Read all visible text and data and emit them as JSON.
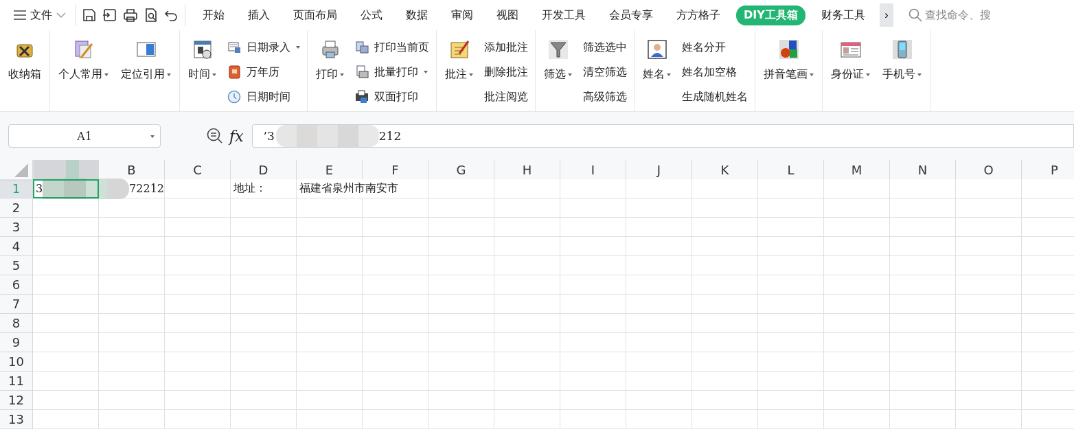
{
  "menu_button": {
    "label": "文件"
  },
  "tabs": [
    {
      "label": "开始",
      "selected": false
    },
    {
      "label": "插入",
      "selected": false
    },
    {
      "label": "页面布局",
      "selected": false
    },
    {
      "label": "公式",
      "selected": false
    },
    {
      "label": "数据",
      "selected": false
    },
    {
      "label": "审阅",
      "selected": false
    },
    {
      "label": "视图",
      "selected": false
    },
    {
      "label": "开发工具",
      "selected": false
    },
    {
      "label": "会员专享",
      "selected": false
    },
    {
      "label": "方方格子",
      "selected": false
    },
    {
      "label": "DIY工具箱",
      "selected": true
    },
    {
      "label": "财务工具",
      "selected": false
    }
  ],
  "more_tabs": "›",
  "search": {
    "placeholder": "查找命令、搜"
  },
  "ribbon_groups": [
    {
      "items": [
        {
          "kind": "large",
          "label": "收纳箱",
          "dropdown": false
        }
      ]
    },
    {
      "items": [
        {
          "kind": "large",
          "label": "个人常用",
          "dropdown": true
        },
        {
          "kind": "large",
          "label": "定位引用",
          "dropdown": true
        }
      ]
    },
    {
      "items": [
        {
          "kind": "large",
          "label": "时间",
          "dropdown": true
        },
        {
          "kind": "column",
          "with_icons": true,
          "items": [
            {
              "label": "日期录入",
              "dropdown": true
            },
            {
              "label": "万年历",
              "dropdown": false
            },
            {
              "label": "日期时间",
              "dropdown": false
            }
          ]
        }
      ]
    },
    {
      "items": [
        {
          "kind": "large",
          "label": "打印",
          "dropdown": true
        },
        {
          "kind": "column",
          "with_icons": true,
          "items": [
            {
              "label": "打印当前页",
              "dropdown": false
            },
            {
              "label": "批量打印",
              "dropdown": true
            },
            {
              "label": "双面打印",
              "dropdown": false
            }
          ]
        }
      ]
    },
    {
      "items": [
        {
          "kind": "large",
          "label": "批注",
          "dropdown": true
        },
        {
          "kind": "column",
          "with_icons": false,
          "items": [
            {
              "label": "添加批注",
              "dropdown": false
            },
            {
              "label": "删除批注",
              "dropdown": false
            },
            {
              "label": "批注阅览",
              "dropdown": false
            }
          ]
        }
      ]
    },
    {
      "items": [
        {
          "kind": "large",
          "label": "筛选",
          "dropdown": true
        },
        {
          "kind": "column",
          "with_icons": false,
          "items": [
            {
              "label": "筛选选中",
              "dropdown": false
            },
            {
              "label": "清空筛选",
              "dropdown": false
            },
            {
              "label": "高级筛选",
              "dropdown": false
            }
          ]
        }
      ]
    },
    {
      "items": [
        {
          "kind": "large",
          "label": "姓名",
          "dropdown": true
        },
        {
          "kind": "column",
          "with_icons": false,
          "items": [
            {
              "label": "姓名分开",
              "dropdown": false
            },
            {
              "label": "姓名加空格",
              "dropdown": false
            },
            {
              "label": "生成随机姓名",
              "dropdown": false
            }
          ]
        }
      ]
    },
    {
      "items": [
        {
          "kind": "large",
          "label": "拼音笔画",
          "dropdown": true
        }
      ]
    },
    {
      "items": [
        {
          "kind": "large",
          "label": "身份证",
          "dropdown": true
        },
        {
          "kind": "large",
          "label": "手机号",
          "dropdown": true
        }
      ]
    }
  ],
  "name_box": {
    "value": "A1"
  },
  "formula_bar": {
    "label": "fx",
    "value_start": "’3",
    "value_end": "212"
  },
  "columns": [
    {
      "selected": true
    },
    {
      "label": "B",
      "selected": false
    },
    {
      "label": "C",
      "selected": false
    },
    {
      "label": "D",
      "selected": false
    },
    {
      "label": "E",
      "selected": false
    },
    {
      "label": "F",
      "selected": false
    },
    {
      "label": "G",
      "selected": false
    },
    {
      "label": "H",
      "selected": false
    },
    {
      "label": "I",
      "selected": false
    },
    {
      "label": "J",
      "selected": false
    },
    {
      "label": "K",
      "selected": false
    },
    {
      "label": "L",
      "selected": false
    },
    {
      "label": "M",
      "selected": false
    },
    {
      "label": "N",
      "selected": false
    },
    {
      "label": "O",
      "selected": false
    },
    {
      "label": "P",
      "selected": false
    }
  ],
  "rows": [
    {
      "label": "1",
      "selected": true,
      "cells": [
        {
          "start": "3",
          "end": "72212",
          "blurred": true
        },
        {},
        {},
        {
          "text": "地址："
        },
        {
          "text": "福建省泉州市南安市"
        }
      ]
    },
    {
      "label": "2",
      "selected": false
    },
    {
      "label": "3",
      "selected": false
    },
    {
      "label": "4",
      "selected": false
    },
    {
      "label": "5",
      "selected": false
    },
    {
      "label": "6",
      "selected": false
    },
    {
      "label": "7",
      "selected": false
    },
    {
      "label": "8",
      "selected": false
    },
    {
      "label": "9",
      "selected": false
    },
    {
      "label": "10",
      "selected": false
    },
    {
      "label": "11",
      "selected": false
    },
    {
      "label": "12",
      "selected": false
    },
    {
      "label": "13",
      "selected": false
    }
  ]
}
